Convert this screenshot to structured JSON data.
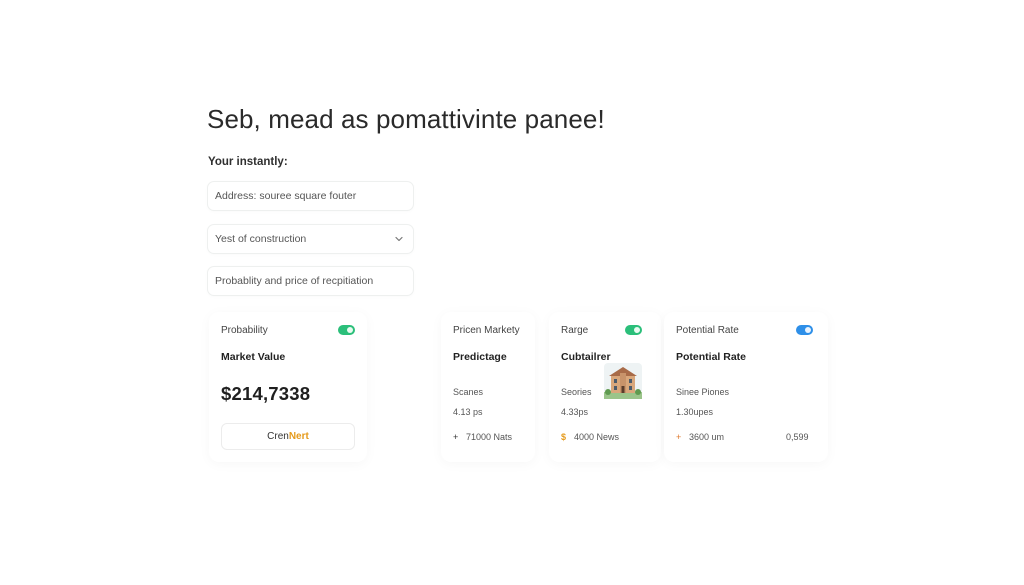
{
  "header": {
    "title": "Seb, mead as pomattivinte panee!"
  },
  "form": {
    "label": "Your instantly:",
    "address_placeholder": "Address: souree square fouter",
    "year_select": "Yest of construction",
    "probability_field": "Probablity and price of recpitiation"
  },
  "cards": {
    "market": {
      "toggle_label": "Probability",
      "title": "Market Value",
      "price": "$214,7338",
      "button_prefix": "Cren ",
      "button_accent": "Nert"
    },
    "predictage": {
      "label": "Pricen Markety",
      "title": "Predictage",
      "sub": "Scanes",
      "value": "4.13 ps",
      "arrow": "+",
      "stat": "71000 Nats"
    },
    "range": {
      "toggle_label": "Rarge",
      "title": "Cubtailrer",
      "sub": "Seories",
      "value": "4.33ps",
      "arrow": "$",
      "stat": "4000 News"
    },
    "potential": {
      "toggle_label": "Potential Rate",
      "title": "Potential Rate",
      "sub": "Sinee Piones",
      "value": "1.30upes",
      "arrow": "+",
      "stat": "3600 um",
      "extra": "0,599"
    }
  },
  "colors": {
    "toggle_green": "#2bbf7a",
    "toggle_blue": "#2e8fe8",
    "accent": "#e59a1b"
  },
  "icons": {
    "chevron": "chevron-down-icon",
    "house": "house-icon"
  }
}
